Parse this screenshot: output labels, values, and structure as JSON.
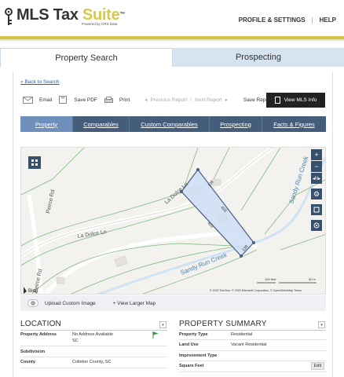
{
  "header": {
    "logo_main": "MLS Tax",
    "logo_accent": "Suite",
    "logo_tm": "™",
    "logo_sub": "Powered by CRS Data",
    "nav": [
      {
        "label": "PROFILE & SETTINGS"
      },
      {
        "label": "HELP"
      }
    ],
    "accent_color": "#d4c449"
  },
  "main_tabs": [
    {
      "label": "Property Search",
      "active": true
    },
    {
      "label": "Prospecting",
      "active": false
    }
  ],
  "back_link": "« Back to Search",
  "toolbar": {
    "email": "Email",
    "save_pdf": "Save PDF",
    "print": "Print",
    "prev_report": "Previous Report",
    "next_report": "Next Report",
    "save_report": "Save Report",
    "view_mls": "View MLS Info",
    "separator": "/"
  },
  "sub_tabs": [
    {
      "label": "Property",
      "active": true
    },
    {
      "label": "Comparables",
      "active": false
    },
    {
      "label": "Custom Comparables",
      "active": false
    },
    {
      "label": "Prospecting",
      "active": false
    },
    {
      "label": "Facts & Figures",
      "active": false
    }
  ],
  "map": {
    "labels": {
      "la_dolce_1": "La Dolce Ln",
      "la_dolce_2": "La Dolce Ln",
      "peirce_1": "Peirce Rd",
      "peirce_2": "Peirce Rd",
      "sandy_1": "Sandy Run Creek",
      "sandy_2": "Sandy Run Creek",
      "dim_top": "128",
      "dim_left": "403",
      "dim_right": "418",
      "dim_bottom": "128"
    },
    "scale_feet": "100 feet",
    "scale_m": "50 m",
    "copyright": "© 2020 TomTom, © 2020 Microsoft Corporation, © OpenStreetMap Terms",
    "bing": "Bing",
    "controls": [
      "plus-icon",
      "minus-icon",
      "compass-icon",
      "gear-icon",
      "crop-icon",
      "locate-icon"
    ]
  },
  "map_footer": {
    "upload": "Upload Custom Image",
    "larger": "+ View Larger Map"
  },
  "location": {
    "title": "LOCATION",
    "rows": [
      {
        "label": "Property Address",
        "value": "No Address Available",
        "value2": "SC"
      },
      {
        "label": "Subdivision",
        "value": ""
      },
      {
        "label": "County",
        "value": "Colleton County, SC"
      }
    ],
    "flag_color": "#2e9b3a"
  },
  "summary": {
    "title": "PROPERTY SUMMARY",
    "rows": [
      {
        "label": "Property Type",
        "value": "Residential"
      },
      {
        "label": "Land Use",
        "value": "Vacant Residential"
      },
      {
        "label": "Improvement Type",
        "value": ""
      },
      {
        "label": "Square Feet",
        "value": ""
      }
    ],
    "edit": "Edit"
  }
}
